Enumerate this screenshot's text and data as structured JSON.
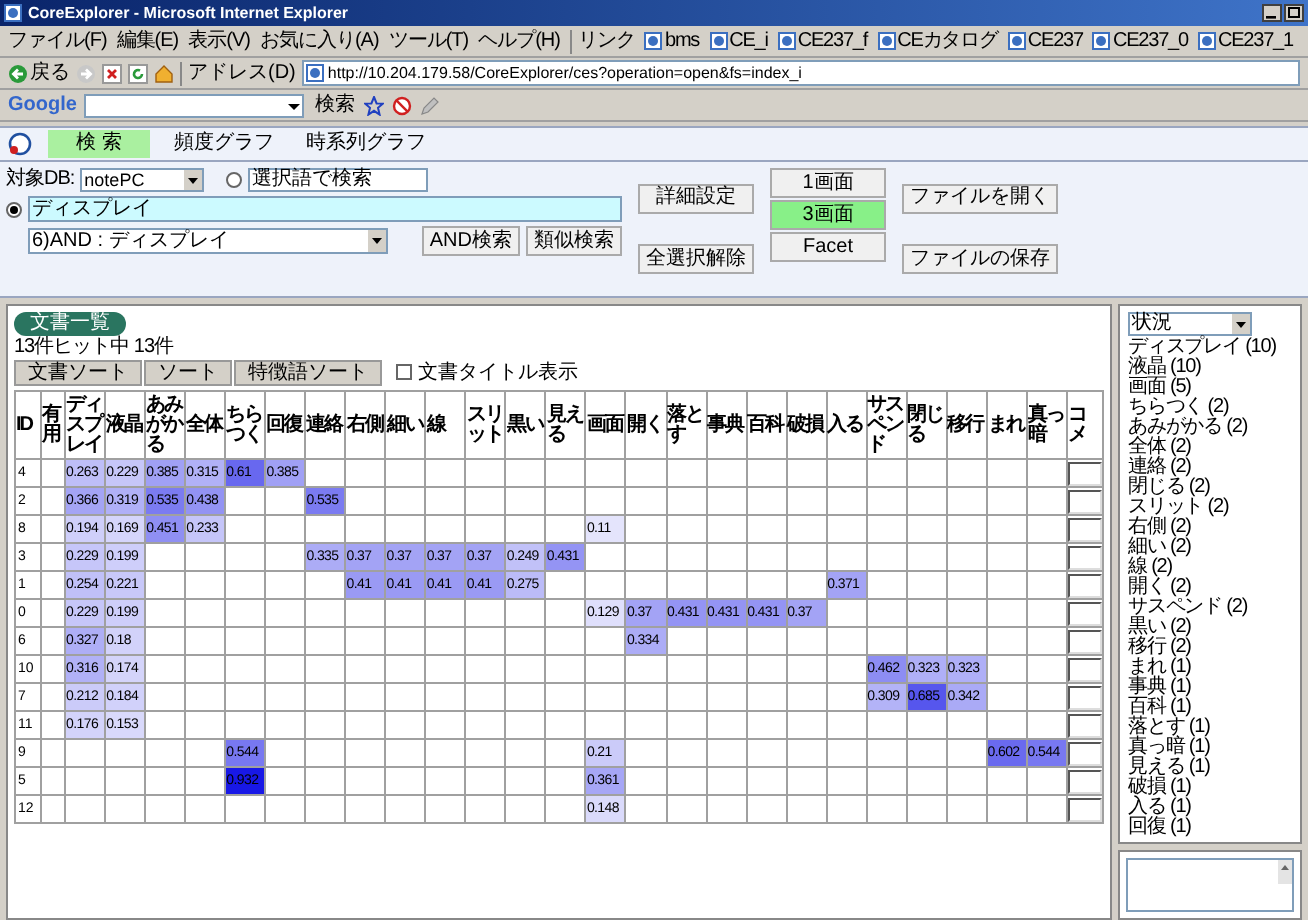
{
  "window": {
    "title": "CoreExplorer - Microsoft Internet Explorer"
  },
  "menu": [
    "ファイル(F)",
    "編集(E)",
    "表示(V)",
    "お気に入り(A)",
    "ツール(T)",
    "ヘルプ(H)"
  ],
  "links": {
    "label": "リンク",
    "items": [
      "bms",
      "CE_i",
      "CE237_f",
      "CEカタログ",
      "CE237",
      "CE237_0",
      "CE237_1"
    ]
  },
  "nav": {
    "back_label": "戻る",
    "address_label": "アドレス(D)",
    "url": "http://10.204.179.58/CoreExplorer/ces?operation=open&fs=index_i"
  },
  "google_bar": {
    "logo": "Google",
    "search_button": "検索"
  },
  "app_tabs": [
    {
      "label": "検 索",
      "selected": true
    },
    {
      "label": "頻度グラフ",
      "selected": false
    },
    {
      "label": "時系列グラフ",
      "selected": false
    }
  ],
  "form": {
    "db_label": "対象DB:",
    "db_value": "notePC",
    "query_options": [
      {
        "value": "選択語で検索",
        "selected": false
      },
      {
        "value": "ディスプレイ",
        "selected": true
      }
    ],
    "history": "6)AND : ディスプレイ",
    "and_button": "AND検索",
    "similar_button": "類似検索",
    "detail_button": "詳細設定",
    "clear_button": "全選択解除",
    "views": [
      {
        "label": "1画面",
        "selected": false
      },
      {
        "label": "3画面",
        "selected": true
      },
      {
        "label": "Facet",
        "selected": false
      }
    ],
    "open_button": "ファイルを開く",
    "save_button": "ファイルの保存"
  },
  "results": {
    "panel_tab": "文書一覧",
    "hit_count": "13件ヒット中 13件",
    "sort_buttons": [
      "文書ソート",
      "ソート",
      "特徴語ソート"
    ],
    "title_toggle": {
      "label": "文書タイトル表示",
      "checked": false
    },
    "columns": [
      "ID",
      "有用",
      "ディスプレイ",
      "液晶",
      "あみがかる",
      "全体",
      "ちらつく",
      "回復",
      "連絡",
      "右側",
      "細い",
      "線",
      "スリット",
      "黒い",
      "見える",
      "画面",
      "開く",
      "落とす",
      "事典",
      "百科",
      "破損",
      "入る",
      "サスペンド",
      "閉じる",
      "移行",
      "まれ",
      "真っ暗",
      "コメ"
    ],
    "rows": [
      {
        "cells": [
          {
            "kind": "id",
            "value": "4"
          },
          {
            "kind": "empty"
          },
          {
            "kind": "score",
            "value": "0.263"
          },
          {
            "kind": "score",
            "value": "0.229"
          },
          {
            "kind": "score",
            "value": "0.385"
          },
          {
            "kind": "score",
            "value": "0.315"
          },
          {
            "kind": "score",
            "value": "0.61"
          },
          {
            "kind": "score",
            "value": "0.385"
          },
          {
            "kind": "empty"
          },
          {
            "kind": "empty"
          },
          {
            "kind": "empty"
          },
          {
            "kind": "empty"
          },
          {
            "kind": "empty"
          },
          {
            "kind": "empty"
          },
          {
            "kind": "empty"
          },
          {
            "kind": "empty"
          },
          {
            "kind": "empty"
          },
          {
            "kind": "empty"
          },
          {
            "kind": "empty"
          },
          {
            "kind": "empty"
          },
          {
            "kind": "empty"
          },
          {
            "kind": "empty"
          },
          {
            "kind": "empty"
          },
          {
            "kind": "empty"
          },
          {
            "kind": "empty"
          },
          {
            "kind": "empty"
          },
          {
            "kind": "empty"
          }
        ]
      },
      {
        "cells": [
          {
            "kind": "id",
            "value": "2"
          },
          {
            "kind": "empty"
          },
          {
            "kind": "score",
            "value": "0.366"
          },
          {
            "kind": "score",
            "value": "0.319"
          },
          {
            "kind": "score",
            "value": "0.535"
          },
          {
            "kind": "score",
            "value": "0.438"
          },
          {
            "kind": "empty"
          },
          {
            "kind": "empty"
          },
          {
            "kind": "score",
            "value": "0.535"
          },
          {
            "kind": "empty"
          },
          {
            "kind": "empty"
          },
          {
            "kind": "empty"
          },
          {
            "kind": "empty"
          },
          {
            "kind": "empty"
          },
          {
            "kind": "empty"
          },
          {
            "kind": "empty"
          },
          {
            "kind": "empty"
          },
          {
            "kind": "empty"
          },
          {
            "kind": "empty"
          },
          {
            "kind": "empty"
          },
          {
            "kind": "empty"
          },
          {
            "kind": "empty"
          },
          {
            "kind": "empty"
          },
          {
            "kind": "empty"
          },
          {
            "kind": "empty"
          },
          {
            "kind": "empty"
          },
          {
            "kind": "empty"
          }
        ]
      },
      {
        "cells": [
          {
            "kind": "id",
            "value": "8"
          },
          {
            "kind": "empty"
          },
          {
            "kind": "score",
            "value": "0.194"
          },
          {
            "kind": "score",
            "value": "0.169"
          },
          {
            "kind": "score",
            "value": "0.451"
          },
          {
            "kind": "score",
            "value": "0.233"
          },
          {
            "kind": "empty"
          },
          {
            "kind": "empty"
          },
          {
            "kind": "empty"
          },
          {
            "kind": "empty"
          },
          {
            "kind": "empty"
          },
          {
            "kind": "empty"
          },
          {
            "kind": "empty"
          },
          {
            "kind": "empty"
          },
          {
            "kind": "empty"
          },
          {
            "kind": "score",
            "value": "0.11"
          },
          {
            "kind": "empty"
          },
          {
            "kind": "empty"
          },
          {
            "kind": "empty"
          },
          {
            "kind": "empty"
          },
          {
            "kind": "empty"
          },
          {
            "kind": "empty"
          },
          {
            "kind": "empty"
          },
          {
            "kind": "empty"
          },
          {
            "kind": "empty"
          },
          {
            "kind": "empty"
          },
          {
            "kind": "empty"
          }
        ]
      },
      {
        "cells": [
          {
            "kind": "id",
            "value": "3"
          },
          {
            "kind": "empty"
          },
          {
            "kind": "score",
            "value": "0.229"
          },
          {
            "kind": "score",
            "value": "0.199"
          },
          {
            "kind": "empty"
          },
          {
            "kind": "empty"
          },
          {
            "kind": "empty"
          },
          {
            "kind": "empty"
          },
          {
            "kind": "score",
            "value": "0.335"
          },
          {
            "kind": "score",
            "value": "0.37"
          },
          {
            "kind": "score",
            "value": "0.37"
          },
          {
            "kind": "score",
            "value": "0.37"
          },
          {
            "kind": "score",
            "value": "0.37"
          },
          {
            "kind": "score",
            "value": "0.249"
          },
          {
            "kind": "score",
            "value": "0.431"
          },
          {
            "kind": "empty"
          },
          {
            "kind": "empty"
          },
          {
            "kind": "empty"
          },
          {
            "kind": "empty"
          },
          {
            "kind": "empty"
          },
          {
            "kind": "empty"
          },
          {
            "kind": "empty"
          },
          {
            "kind": "empty"
          },
          {
            "kind": "empty"
          },
          {
            "kind": "empty"
          },
          {
            "kind": "empty"
          },
          {
            "kind": "empty"
          }
        ]
      },
      {
        "cells": [
          {
            "kind": "id",
            "value": "1"
          },
          {
            "kind": "empty"
          },
          {
            "kind": "score",
            "value": "0.254"
          },
          {
            "kind": "score",
            "value": "0.221"
          },
          {
            "kind": "empty"
          },
          {
            "kind": "empty"
          },
          {
            "kind": "empty"
          },
          {
            "kind": "empty"
          },
          {
            "kind": "empty"
          },
          {
            "kind": "score",
            "value": "0.41"
          },
          {
            "kind": "score",
            "value": "0.41"
          },
          {
            "kind": "score",
            "value": "0.41"
          },
          {
            "kind": "score",
            "value": "0.41"
          },
          {
            "kind": "score",
            "value": "0.275"
          },
          {
            "kind": "empty"
          },
          {
            "kind": "empty"
          },
          {
            "kind": "empty"
          },
          {
            "kind": "empty"
          },
          {
            "kind": "empty"
          },
          {
            "kind": "empty"
          },
          {
            "kind": "empty"
          },
          {
            "kind": "score",
            "value": "0.371"
          },
          {
            "kind": "empty"
          },
          {
            "kind": "empty"
          },
          {
            "kind": "empty"
          },
          {
            "kind": "empty"
          },
          {
            "kind": "empty"
          }
        ]
      },
      {
        "cells": [
          {
            "kind": "id",
            "value": "0"
          },
          {
            "kind": "empty"
          },
          {
            "kind": "score",
            "value": "0.229"
          },
          {
            "kind": "score",
            "value": "0.199"
          },
          {
            "kind": "empty"
          },
          {
            "kind": "empty"
          },
          {
            "kind": "empty"
          },
          {
            "kind": "empty"
          },
          {
            "kind": "empty"
          },
          {
            "kind": "empty"
          },
          {
            "kind": "empty"
          },
          {
            "kind": "empty"
          },
          {
            "kind": "empty"
          },
          {
            "kind": "empty"
          },
          {
            "kind": "empty"
          },
          {
            "kind": "score",
            "value": "0.129"
          },
          {
            "kind": "score",
            "value": "0.37"
          },
          {
            "kind": "score",
            "value": "0.431"
          },
          {
            "kind": "score",
            "value": "0.431"
          },
          {
            "kind": "score",
            "value": "0.431"
          },
          {
            "kind": "score",
            "value": "0.37"
          },
          {
            "kind": "empty"
          },
          {
            "kind": "empty"
          },
          {
            "kind": "empty"
          },
          {
            "kind": "empty"
          },
          {
            "kind": "empty"
          },
          {
            "kind": "empty"
          }
        ]
      },
      {
        "cells": [
          {
            "kind": "id",
            "value": "6"
          },
          {
            "kind": "empty"
          },
          {
            "kind": "score",
            "value": "0.327"
          },
          {
            "kind": "score",
            "value": "0.18"
          },
          {
            "kind": "empty"
          },
          {
            "kind": "empty"
          },
          {
            "kind": "empty"
          },
          {
            "kind": "empty"
          },
          {
            "kind": "empty"
          },
          {
            "kind": "empty"
          },
          {
            "kind": "empty"
          },
          {
            "kind": "empty"
          },
          {
            "kind": "empty"
          },
          {
            "kind": "empty"
          },
          {
            "kind": "empty"
          },
          {
            "kind": "empty"
          },
          {
            "kind": "score",
            "value": "0.334"
          },
          {
            "kind": "empty"
          },
          {
            "kind": "empty"
          },
          {
            "kind": "empty"
          },
          {
            "kind": "empty"
          },
          {
            "kind": "empty"
          },
          {
            "kind": "empty"
          },
          {
            "kind": "empty"
          },
          {
            "kind": "empty"
          },
          {
            "kind": "empty"
          },
          {
            "kind": "empty"
          }
        ]
      },
      {
        "cells": [
          {
            "kind": "id",
            "value": "10"
          },
          {
            "kind": "empty"
          },
          {
            "kind": "score",
            "value": "0.316"
          },
          {
            "kind": "score",
            "value": "0.174"
          },
          {
            "kind": "empty"
          },
          {
            "kind": "empty"
          },
          {
            "kind": "empty"
          },
          {
            "kind": "empty"
          },
          {
            "kind": "empty"
          },
          {
            "kind": "empty"
          },
          {
            "kind": "empty"
          },
          {
            "kind": "empty"
          },
          {
            "kind": "empty"
          },
          {
            "kind": "empty"
          },
          {
            "kind": "empty"
          },
          {
            "kind": "empty"
          },
          {
            "kind": "empty"
          },
          {
            "kind": "empty"
          },
          {
            "kind": "empty"
          },
          {
            "kind": "empty"
          },
          {
            "kind": "empty"
          },
          {
            "kind": "empty"
          },
          {
            "kind": "score",
            "value": "0.462"
          },
          {
            "kind": "score",
            "value": "0.323"
          },
          {
            "kind": "score",
            "value": "0.323"
          },
          {
            "kind": "empty"
          },
          {
            "kind": "empty"
          }
        ]
      },
      {
        "cells": [
          {
            "kind": "id",
            "value": "7"
          },
          {
            "kind": "empty"
          },
          {
            "kind": "score",
            "value": "0.212"
          },
          {
            "kind": "score",
            "value": "0.184"
          },
          {
            "kind": "empty"
          },
          {
            "kind": "empty"
          },
          {
            "kind": "empty"
          },
          {
            "kind": "empty"
          },
          {
            "kind": "empty"
          },
          {
            "kind": "empty"
          },
          {
            "kind": "empty"
          },
          {
            "kind": "empty"
          },
          {
            "kind": "empty"
          },
          {
            "kind": "empty"
          },
          {
            "kind": "empty"
          },
          {
            "kind": "empty"
          },
          {
            "kind": "empty"
          },
          {
            "kind": "empty"
          },
          {
            "kind": "empty"
          },
          {
            "kind": "empty"
          },
          {
            "kind": "empty"
          },
          {
            "kind": "empty"
          },
          {
            "kind": "score",
            "value": "0.309"
          },
          {
            "kind": "score",
            "value": "0.685"
          },
          {
            "kind": "score",
            "value": "0.342"
          },
          {
            "kind": "empty"
          },
          {
            "kind": "empty"
          }
        ]
      },
      {
        "cells": [
          {
            "kind": "id",
            "value": "11"
          },
          {
            "kind": "empty"
          },
          {
            "kind": "score",
            "value": "0.176"
          },
          {
            "kind": "score",
            "value": "0.153"
          },
          {
            "kind": "empty"
          },
          {
            "kind": "empty"
          },
          {
            "kind": "empty"
          },
          {
            "kind": "empty"
          },
          {
            "kind": "empty"
          },
          {
            "kind": "empty"
          },
          {
            "kind": "empty"
          },
          {
            "kind": "empty"
          },
          {
            "kind": "empty"
          },
          {
            "kind": "empty"
          },
          {
            "kind": "empty"
          },
          {
            "kind": "empty"
          },
          {
            "kind": "empty"
          },
          {
            "kind": "empty"
          },
          {
            "kind": "empty"
          },
          {
            "kind": "empty"
          },
          {
            "kind": "empty"
          },
          {
            "kind": "empty"
          },
          {
            "kind": "empty"
          },
          {
            "kind": "empty"
          },
          {
            "kind": "empty"
          },
          {
            "kind": "empty"
          },
          {
            "kind": "empty"
          }
        ]
      },
      {
        "cells": [
          {
            "kind": "id",
            "value": "9"
          },
          {
            "kind": "empty"
          },
          {
            "kind": "empty"
          },
          {
            "kind": "empty"
          },
          {
            "kind": "empty"
          },
          {
            "kind": "empty"
          },
          {
            "kind": "score",
            "value": "0.544"
          },
          {
            "kind": "empty"
          },
          {
            "kind": "empty"
          },
          {
            "kind": "empty"
          },
          {
            "kind": "empty"
          },
          {
            "kind": "empty"
          },
          {
            "kind": "empty"
          },
          {
            "kind": "empty"
          },
          {
            "kind": "empty"
          },
          {
            "kind": "score",
            "value": "0.21"
          },
          {
            "kind": "empty"
          },
          {
            "kind": "empty"
          },
          {
            "kind": "empty"
          },
          {
            "kind": "empty"
          },
          {
            "kind": "empty"
          },
          {
            "kind": "empty"
          },
          {
            "kind": "empty"
          },
          {
            "kind": "empty"
          },
          {
            "kind": "empty"
          },
          {
            "kind": "score",
            "value": "0.602"
          },
          {
            "kind": "score",
            "value": "0.544"
          }
        ]
      },
      {
        "cells": [
          {
            "kind": "id",
            "value": "5"
          },
          {
            "kind": "empty"
          },
          {
            "kind": "empty"
          },
          {
            "kind": "empty"
          },
          {
            "kind": "empty"
          },
          {
            "kind": "empty"
          },
          {
            "kind": "score",
            "value": "0.932"
          },
          {
            "kind": "empty"
          },
          {
            "kind": "empty"
          },
          {
            "kind": "empty"
          },
          {
            "kind": "empty"
          },
          {
            "kind": "empty"
          },
          {
            "kind": "empty"
          },
          {
            "kind": "empty"
          },
          {
            "kind": "empty"
          },
          {
            "kind": "score",
            "value": "0.361"
          },
          {
            "kind": "empty"
          },
          {
            "kind": "empty"
          },
          {
            "kind": "empty"
          },
          {
            "kind": "empty"
          },
          {
            "kind": "empty"
          },
          {
            "kind": "empty"
          },
          {
            "kind": "empty"
          },
          {
            "kind": "empty"
          },
          {
            "kind": "empty"
          },
          {
            "kind": "empty"
          },
          {
            "kind": "empty"
          }
        ]
      },
      {
        "cells": [
          {
            "kind": "id",
            "value": "12"
          },
          {
            "kind": "empty"
          },
          {
            "kind": "empty"
          },
          {
            "kind": "empty"
          },
          {
            "kind": "empty"
          },
          {
            "kind": "empty"
          },
          {
            "kind": "empty"
          },
          {
            "kind": "empty"
          },
          {
            "kind": "empty"
          },
          {
            "kind": "empty"
          },
          {
            "kind": "empty"
          },
          {
            "kind": "empty"
          },
          {
            "kind": "empty"
          },
          {
            "kind": "empty"
          },
          {
            "kind": "empty"
          },
          {
            "kind": "score",
            "value": "0.148"
          },
          {
            "kind": "empty"
          },
          {
            "kind": "empty"
          },
          {
            "kind": "empty"
          },
          {
            "kind": "empty"
          },
          {
            "kind": "empty"
          },
          {
            "kind": "empty"
          },
          {
            "kind": "empty"
          },
          {
            "kind": "empty"
          },
          {
            "kind": "empty"
          },
          {
            "kind": "empty"
          },
          {
            "kind": "empty"
          }
        ]
      }
    ]
  },
  "facet": {
    "select": "状況",
    "items": [
      "ディスプレイ (10)",
      "液晶 (10)",
      "画面 (5)",
      "ちらつく (2)",
      "あみがかる (2)",
      "全体 (2)",
      "連絡 (2)",
      "閉じる (2)",
      "スリット (2)",
      "右側 (2)",
      "細い (2)",
      "線 (2)",
      "開く (2)",
      "サスペンド (2)",
      "黒い (2)",
      "移行 (2)",
      "まれ (1)",
      "事典 (1)",
      "百科 (1)",
      "落とす (1)",
      "真っ暗 (1)",
      "見える (1)",
      "破損 (1)",
      "入る (1)",
      "回復 (1)"
    ]
  }
}
